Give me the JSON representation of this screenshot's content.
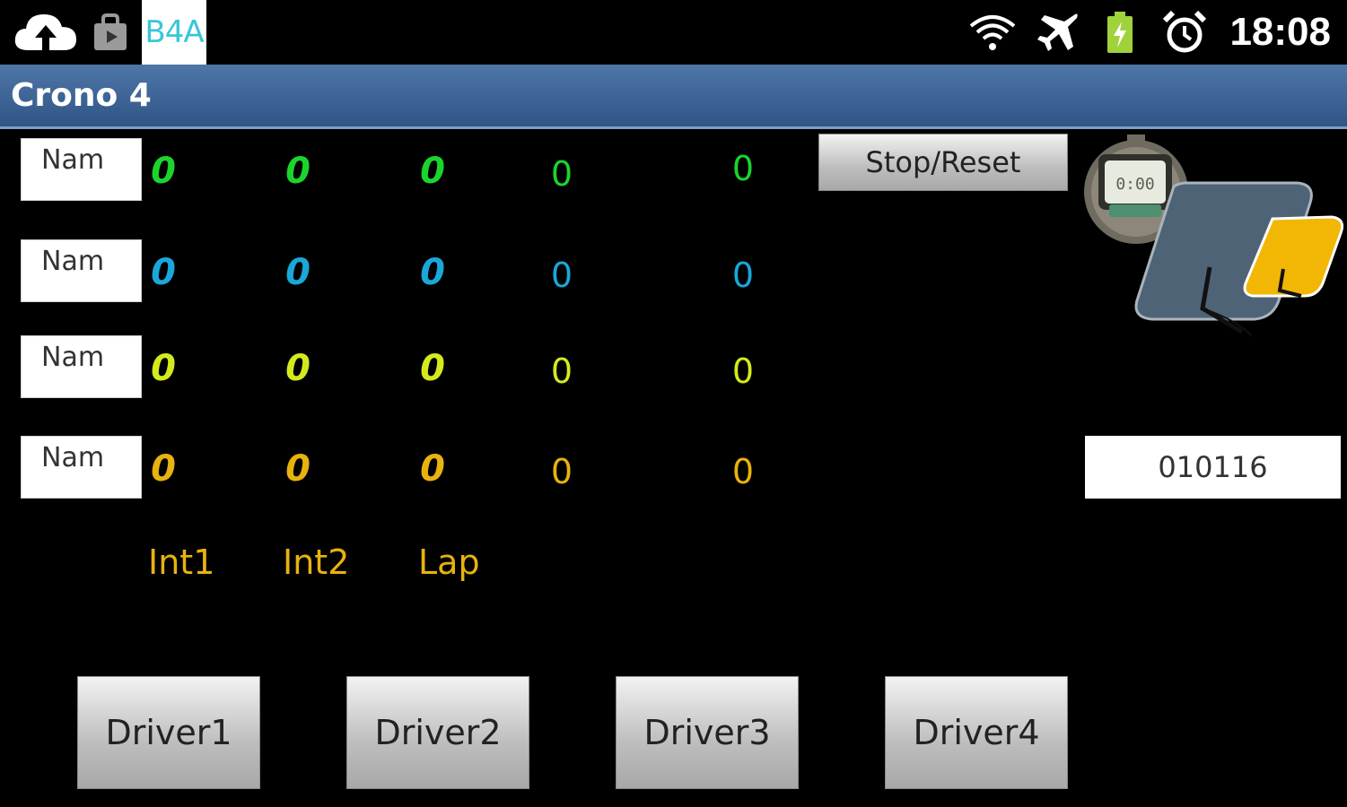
{
  "status_bar": {
    "app_badge": "B4A",
    "time": "18:08",
    "icons": [
      "upload-cloud-icon",
      "shopping-bag-icon",
      "wifi-icon",
      "airplane-icon",
      "battery-charging-icon",
      "alarm-icon"
    ]
  },
  "title_bar": {
    "title": "Crono 4"
  },
  "drivers": [
    {
      "name_field": "Nam",
      "int1": "0",
      "int2": "0",
      "lap": "0",
      "col4": "0",
      "col5": "0",
      "color": "#1bd42c"
    },
    {
      "name_field": "Nam",
      "int1": "0",
      "int2": "0",
      "lap": "0",
      "col4": "0",
      "col5": "0",
      "color": "#1aa7d9"
    },
    {
      "name_field": "Nam",
      "int1": "0",
      "int2": "0",
      "lap": "0",
      "col4": "0",
      "col5": "0",
      "color": "#d4ea1d"
    },
    {
      "name_field": "Nam",
      "int1": "0",
      "int2": "0",
      "lap": "0",
      "col4": "0",
      "col5": "0",
      "color": "#e8b20f"
    }
  ],
  "column_labels": {
    "int1": "Int1",
    "int2": "Int2",
    "lap": "Lap"
  },
  "stop_reset_label": "Stop/Reset",
  "code_field_value": "010116",
  "logo_display": "0:00",
  "driver_buttons": [
    "Driver1",
    "Driver2",
    "Driver3",
    "Driver4"
  ],
  "colors": {
    "title_bar": "#3f6699",
    "label_color": "#e8b20f",
    "b4a_text": "#39c6d6"
  }
}
